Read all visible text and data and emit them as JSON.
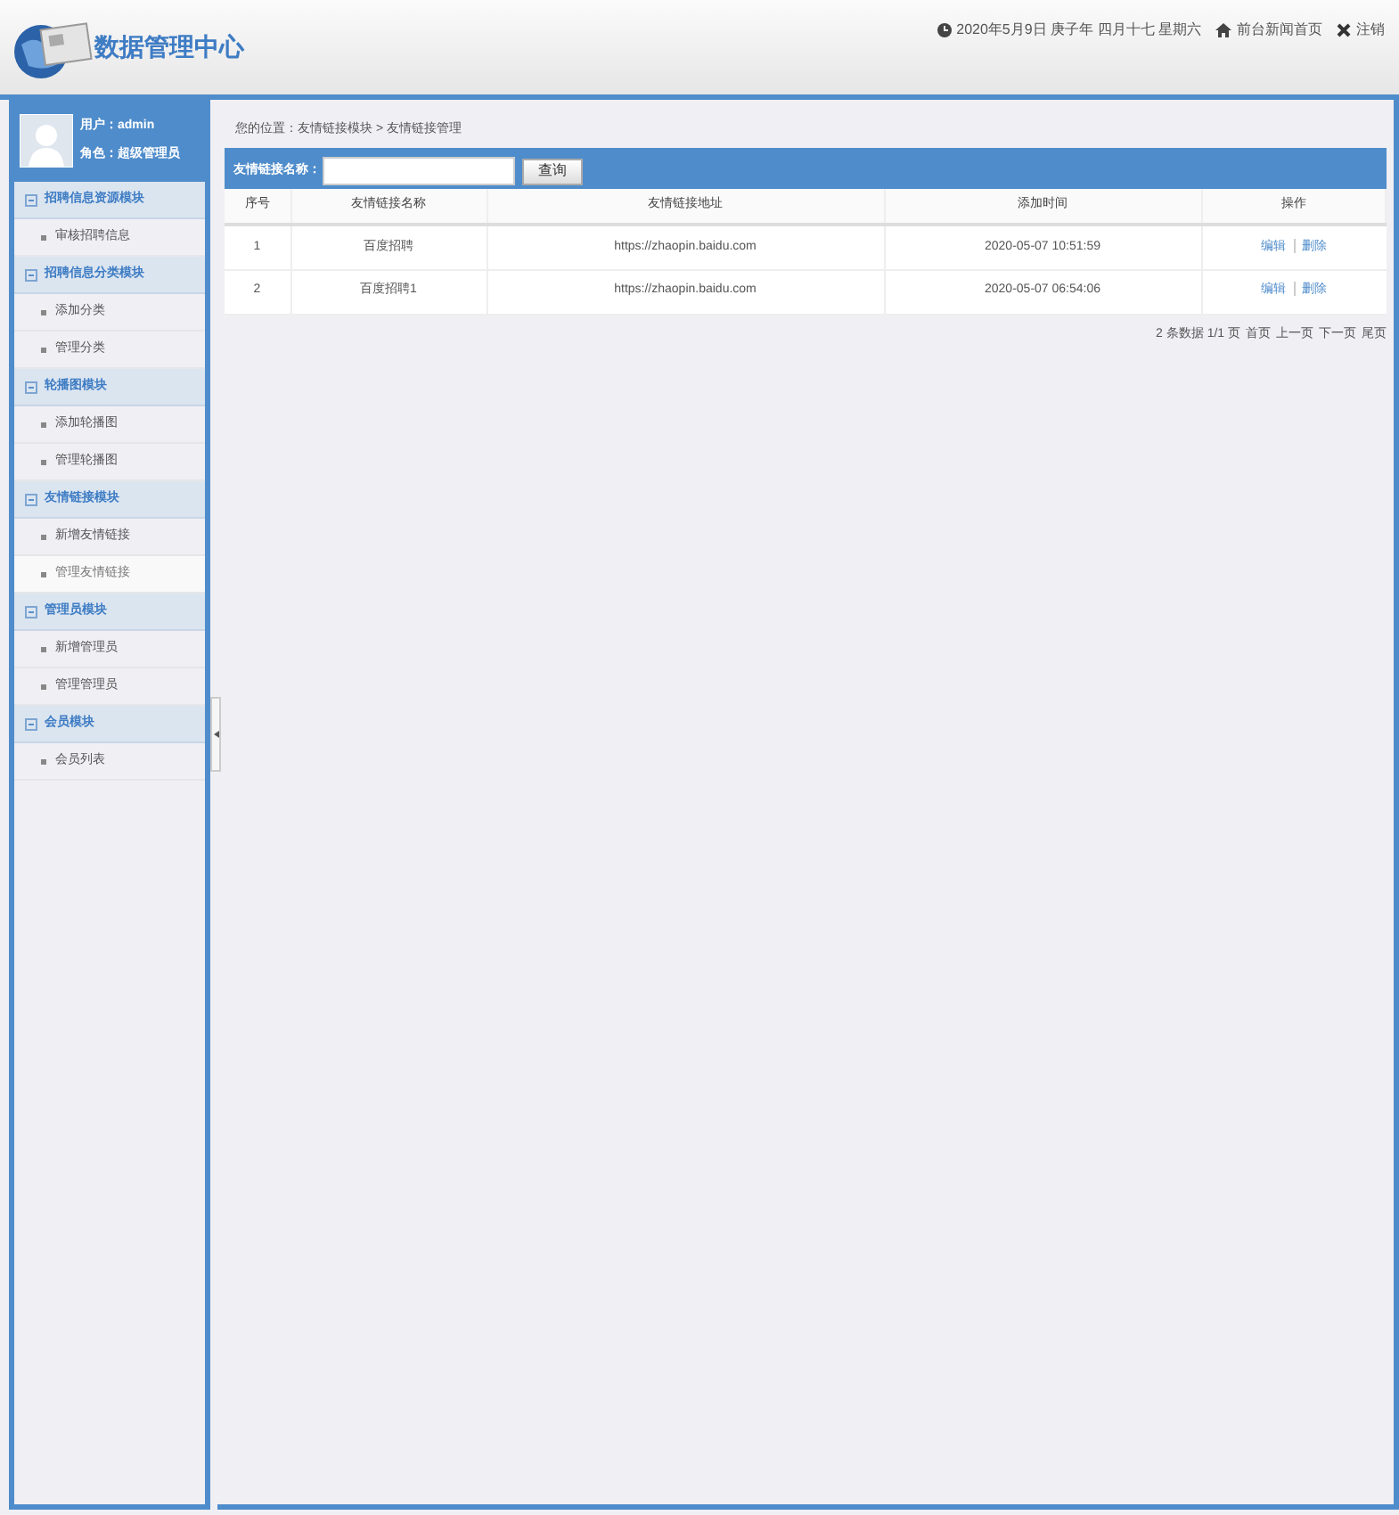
{
  "header": {
    "title": "数据管理中心",
    "date": "2020年5月9日 庚子年 四月十七 星期六",
    "links": [
      {
        "kind": "home",
        "label": "前台新闻首页"
      },
      {
        "kind": "logout",
        "label": "注销"
      }
    ]
  },
  "user": {
    "name": "用户：admin",
    "role": "角色：超级管理员"
  },
  "sidebar": {
    "groups": [
      {
        "title": "招聘信息资源模块",
        "expanded": true,
        "items": [
          {
            "label": "审核招聘信息",
            "selected": false
          }
        ]
      },
      {
        "title": "招聘信息分类模块",
        "expanded": true,
        "items": [
          {
            "label": "添加分类",
            "selected": false
          },
          {
            "label": "管理分类",
            "selected": false
          }
        ]
      },
      {
        "title": "轮播图模块",
        "expanded": true,
        "items": [
          {
            "label": "添加轮播图",
            "selected": false
          },
          {
            "label": "管理轮播图",
            "selected": false
          }
        ]
      },
      {
        "title": "友情链接模块",
        "expanded": true,
        "items": [
          {
            "label": "新增友情链接",
            "selected": false
          },
          {
            "label": "管理友情链接",
            "selected": true
          }
        ]
      },
      {
        "title": "管理员模块",
        "expanded": true,
        "items": [
          {
            "label": "新增管理员",
            "selected": false
          },
          {
            "label": "管理管理员",
            "selected": false
          }
        ]
      },
      {
        "title": "会员模块",
        "expanded": true,
        "items": [
          {
            "label": "会员列表",
            "selected": false
          }
        ]
      }
    ]
  },
  "breadcrumb": "您的位置：友情链接模块 > 友情链接管理",
  "search": {
    "label": "友情链接名称：",
    "button": "查询"
  },
  "table": {
    "columns": [
      "序号",
      "友情链接名称",
      "友情链接地址",
      "添加时间",
      "操作"
    ],
    "rows": [
      {
        "cells": [
          "1",
          "百度招聘",
          "https://zhaopin.baidu.com",
          "2020-05-07 10:51:59"
        ],
        "actions": [
          "编辑",
          "删除"
        ]
      },
      {
        "cells": [
          "2",
          "百度招聘1",
          "https://zhaopin.baidu.com",
          "2020-05-07 06:54:06"
        ],
        "actions": [
          "编辑",
          "删除"
        ]
      }
    ]
  },
  "pagination": {
    "summary": "2 条数据 1/1 页",
    "links": [
      "首页",
      "上一页",
      "下一页",
      "尾页"
    ]
  }
}
